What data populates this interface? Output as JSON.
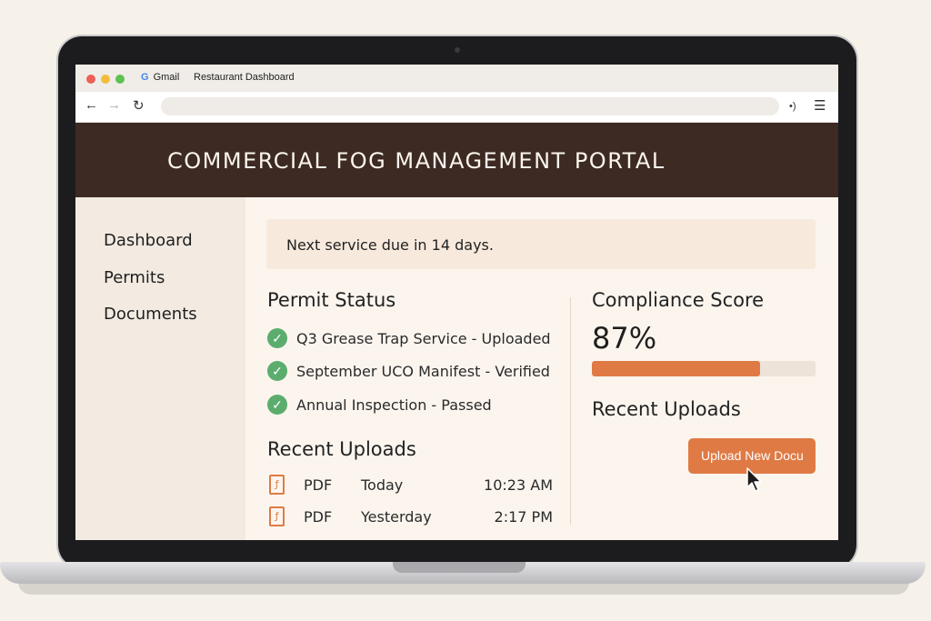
{
  "browser": {
    "tabs": [
      {
        "label": "Gmail"
      },
      {
        "label": "Restaurant Dashboard"
      }
    ],
    "icons": {
      "back": "arrow-left-icon",
      "forward": "arrow-right-icon",
      "reload": "reload-icon",
      "audio": "audio-icon",
      "menu": "menu-icon"
    }
  },
  "header": {
    "title": "COMMERCIAL FOG MANAGEMENT PORTAL"
  },
  "sidebar": {
    "items": [
      {
        "label": "Dashboard"
      },
      {
        "label": "Permits"
      },
      {
        "label": "Documents"
      }
    ]
  },
  "notice": {
    "text": "Next service due in 14 days."
  },
  "permit_status": {
    "title": "Permit Status",
    "items": [
      {
        "text": "Q3 Grease Trap Service - Uploaded",
        "status": "ok"
      },
      {
        "text": "September UCO Manifest - Verified",
        "status": "ok"
      },
      {
        "text": "Annual Inspection - Passed",
        "status": "ok"
      }
    ]
  },
  "recent_uploads": {
    "title": "Recent Uploads",
    "rows": [
      {
        "type": "PDF",
        "day": "Today",
        "time": "10:23 AM"
      },
      {
        "type": "PDF",
        "day": "Yesterday",
        "time": "2:17 PM"
      }
    ]
  },
  "compliance": {
    "title": "Compliance Score",
    "score_text": "87%",
    "score_value": 0.75
  },
  "right_uploads": {
    "title": "Recent Uploads",
    "button_label": "Upload New Docu"
  },
  "colors": {
    "header_bg": "#3c2a23",
    "accent": "#e07a45",
    "success": "#5cad6d",
    "page_bg": "#fbf5ee"
  }
}
